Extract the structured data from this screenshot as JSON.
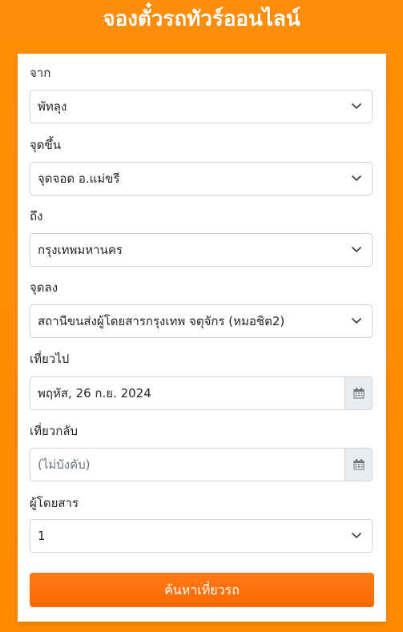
{
  "page": {
    "title": "จองตั๋วรถทัวร์ออนไลน์"
  },
  "form": {
    "from": {
      "label": "จาก",
      "value": "พัทลุง"
    },
    "pickup": {
      "label": "จุดขึ้น",
      "value": "จุดจอด อ.แม่ขรี"
    },
    "to": {
      "label": "ถึง",
      "value": "กรุงเทพมหานคร"
    },
    "dropoff": {
      "label": "จุดลง",
      "value": "สถานีขนส่งผู้โดยสารกรุงเทพ จตุจักร (หมอชิต2)"
    },
    "depart": {
      "label": "เที่ยวไป",
      "value": "พฤหัส, 26 ก.ย. 2024"
    },
    "return": {
      "label": "เที่ยวกลับ",
      "placeholder": "(ไม่บังคับ)"
    },
    "passengers": {
      "label": "ผู้โดยสาร",
      "value": "1"
    },
    "submit_label": "ค้นหาเที่ยวรถ"
  },
  "icons": {
    "select_arrow": "chevron-down-icon",
    "date_picker": "calendar-icon"
  },
  "colors": {
    "background": "#ff8a00",
    "button": "#ff6a00",
    "text": "#212529"
  }
}
